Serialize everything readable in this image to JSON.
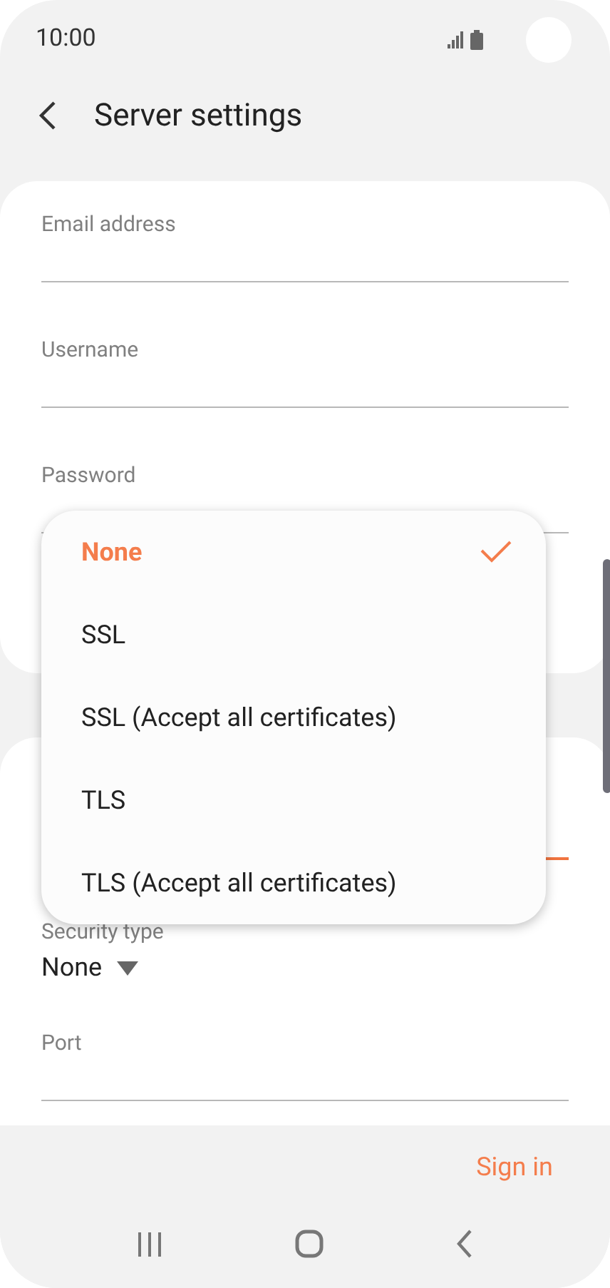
{
  "status_bar": {
    "time": "10:00"
  },
  "header": {
    "title": "Server settings"
  },
  "account_fields": [
    {
      "label": "Email address"
    },
    {
      "label": "Username"
    },
    {
      "label": "Password"
    }
  ],
  "server_fields": [
    {
      "kind": "hidden",
      "focused": true
    },
    {
      "kind": "dropdown",
      "label": "Security type",
      "value": "None"
    },
    {
      "kind": "text",
      "label": "Port",
      "focused": false
    }
  ],
  "security_menu": {
    "options": [
      {
        "label": "None",
        "selected": true
      },
      {
        "label": "SSL",
        "selected": false
      },
      {
        "label": "SSL (Accept all certificates)",
        "selected": false
      },
      {
        "label": "TLS",
        "selected": false
      },
      {
        "label": "TLS (Accept all certificates)",
        "selected": false
      }
    ]
  },
  "footer": {
    "button": "Sign in"
  }
}
